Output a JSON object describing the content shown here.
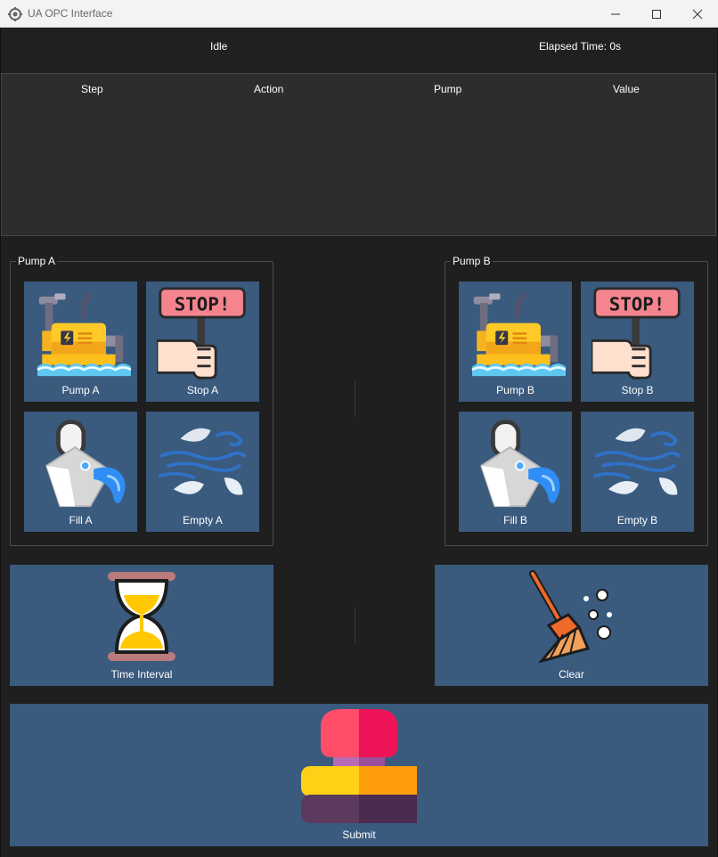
{
  "window": {
    "title": "UA OPC Interface",
    "icon": "gear-app-icon"
  },
  "status": {
    "state": "Idle",
    "elapsed": "Elapsed Time: 0s"
  },
  "table": {
    "columns": [
      "Step",
      "Action",
      "Pump",
      "Value"
    ],
    "rows": []
  },
  "pump_a": {
    "title": "Pump A",
    "buttons": {
      "pump": "Pump A",
      "stop": "Stop A",
      "fill": "Fill A",
      "empty": "Empty A"
    }
  },
  "pump_b": {
    "title": "Pump B",
    "buttons": {
      "pump": "Pump B",
      "stop": "Stop B",
      "fill": "Fill B",
      "empty": "Empty B"
    }
  },
  "controls": {
    "time_interval": "Time Interval",
    "clear": "Clear",
    "submit": "Submit"
  },
  "icons": {
    "pump": "water-pump-icon",
    "stop": "stop-sign-hand-icon",
    "fill": "bucket-pour-icon",
    "empty": "wind-leaves-icon",
    "time": "hourglass-icon",
    "clear": "broom-icon",
    "submit": "push-button-icon"
  },
  "colors": {
    "tile": "#3a5a7e",
    "background": "#1f1f1f",
    "table": "#2d2d2d"
  }
}
